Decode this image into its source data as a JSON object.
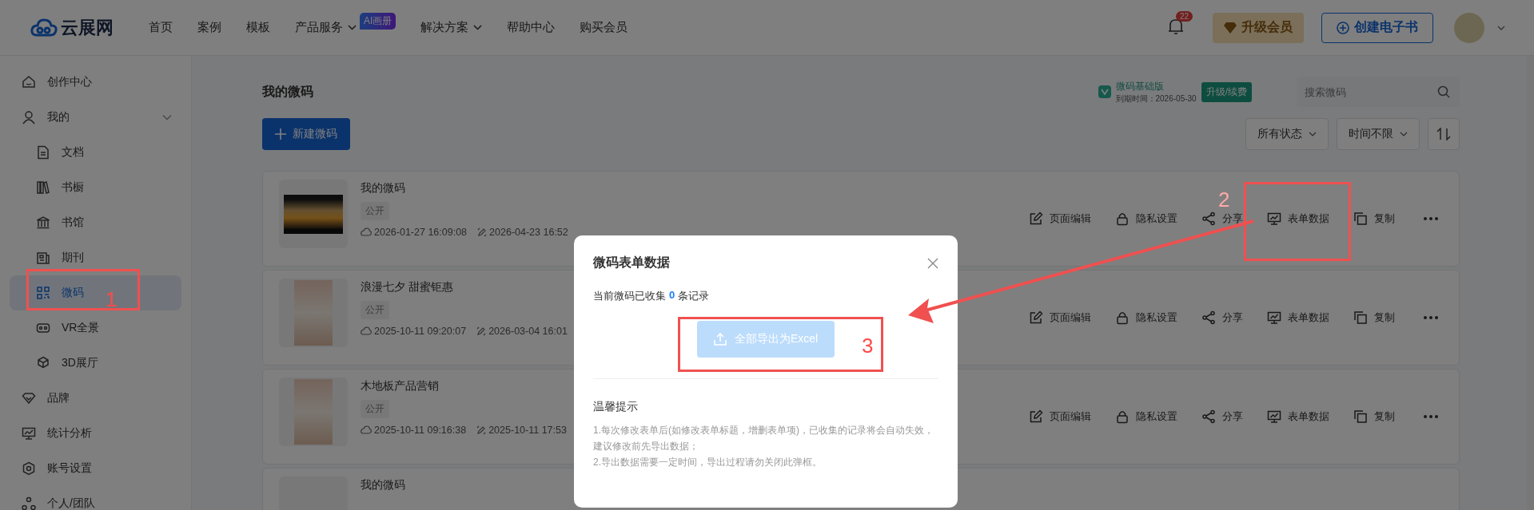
{
  "header": {
    "logo": "云展网",
    "nav": [
      {
        "label": "首页",
        "dropdown": false
      },
      {
        "label": "案例",
        "dropdown": false
      },
      {
        "label": "模板",
        "dropdown": false
      },
      {
        "label": "产品服务",
        "dropdown": true,
        "badge": "AI画册"
      },
      {
        "label": "解决方案",
        "dropdown": true
      },
      {
        "label": "帮助中心",
        "dropdown": false
      },
      {
        "label": "购买会员",
        "dropdown": false
      }
    ],
    "notifications": "22",
    "upgrade_button": "升级会员",
    "create_button": "创建电子书"
  },
  "sidebar": {
    "items": [
      {
        "label": "创作中心",
        "selected": false
      },
      {
        "label": "我的",
        "selected": false,
        "expanded": true,
        "children": [
          {
            "label": "文档",
            "selected": false
          },
          {
            "label": "书橱",
            "selected": false
          },
          {
            "label": "书馆",
            "selected": false
          },
          {
            "label": "期刊",
            "selected": false
          },
          {
            "label": "微码",
            "selected": true
          },
          {
            "label": "VR全景",
            "selected": false
          },
          {
            "label": "3D展厅",
            "selected": false
          }
        ]
      },
      {
        "label": "品牌",
        "selected": false
      },
      {
        "label": "统计分析",
        "selected": false
      },
      {
        "label": "账号设置",
        "selected": false
      },
      {
        "label": "个人/团队",
        "selected": false
      }
    ]
  },
  "page": {
    "title": "我的微码",
    "plan": {
      "name": "微码基础版",
      "expiry": "到期时间：2026-05-30",
      "renew": "升级/续费"
    },
    "search": {
      "placeholder": "搜索微码"
    },
    "new_button": "新建微码",
    "filters": [
      "所有状态",
      "时间不限"
    ]
  },
  "cards": [
    {
      "title": "我的微码",
      "tag": "公开",
      "created": "2026-01-27 16:09:08",
      "modified": "2026-04-23 16:52",
      "actions": [
        "页面编辑",
        "隐私设置",
        "分享",
        "表单数据",
        "复制"
      ]
    },
    {
      "title": "浪漫七夕 甜蜜钜惠",
      "tag": "公开",
      "created": "2025-10-11 09:20:07",
      "modified": "2026-03-04 16:01",
      "actions": [
        "页面编辑",
        "隐私设置",
        "分享",
        "表单数据",
        "复制"
      ]
    },
    {
      "title": "木地板产品营销",
      "tag": "公开",
      "created": "2025-10-11 09:16:38",
      "modified": "2025-10-11 17:53",
      "actions": [
        "页面编辑",
        "隐私设置",
        "分享",
        "表单数据",
        "复制"
      ]
    },
    {
      "title": "我的微码"
    }
  ],
  "dialog": {
    "title": "微码表单数据",
    "count_prefix": "当前微码已收集",
    "count": "0",
    "count_suffix": "条记录",
    "export_button": "全部导出为Excel",
    "export_disabled": true,
    "tips_title": "温馨提示",
    "tips": [
      "1.每次修改表单后(如修改表单标题，增删表单项)，已收集的记录将会自动失效，建议修改前先导出数据；",
      "2.导出数据需要一定时间，导出过程请勿关闭此弹框。"
    ]
  },
  "annotations": [
    "1",
    "2",
    "3"
  ]
}
